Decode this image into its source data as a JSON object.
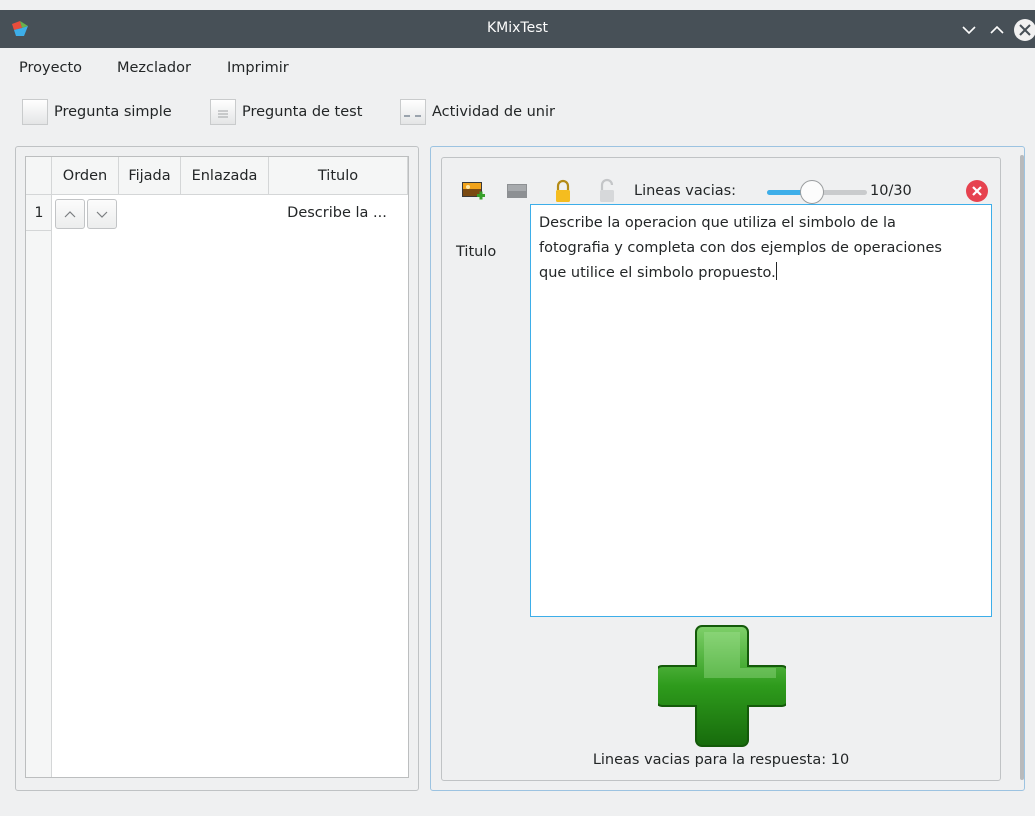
{
  "window": {
    "title": "KMixTest"
  },
  "menubar": {
    "items": [
      "Proyecto",
      "Mezclador",
      "Imprimir"
    ]
  },
  "toolbar": {
    "pregunta_simple": "Pregunta simple",
    "pregunta_test": "Pregunta de test",
    "actividad_unir": "Actividad de unir"
  },
  "table": {
    "headers": [
      "Orden",
      "Fijada",
      "Enlazada",
      "Titulo"
    ],
    "rows": [
      {
        "num": "1",
        "titulo": "Describe la ..."
      }
    ]
  },
  "editor": {
    "lineas_label": "Lineas vacias:",
    "slider": {
      "value": 10,
      "max": 30,
      "text": "10/30"
    },
    "titulo_label": "Titulo",
    "question_text": "Describe la operacion que utiliza el simbolo de la\nfotografia y completa con dos ejemplos de operaciones\nque utilice el simbolo propuesto.",
    "footer_text": "Lineas vacias para la respuesta: 10"
  },
  "colors": {
    "accent": "#3daee9",
    "titlebar": "#475057",
    "close_red": "#e6424f",
    "plus_green": "#2e9b1c"
  }
}
